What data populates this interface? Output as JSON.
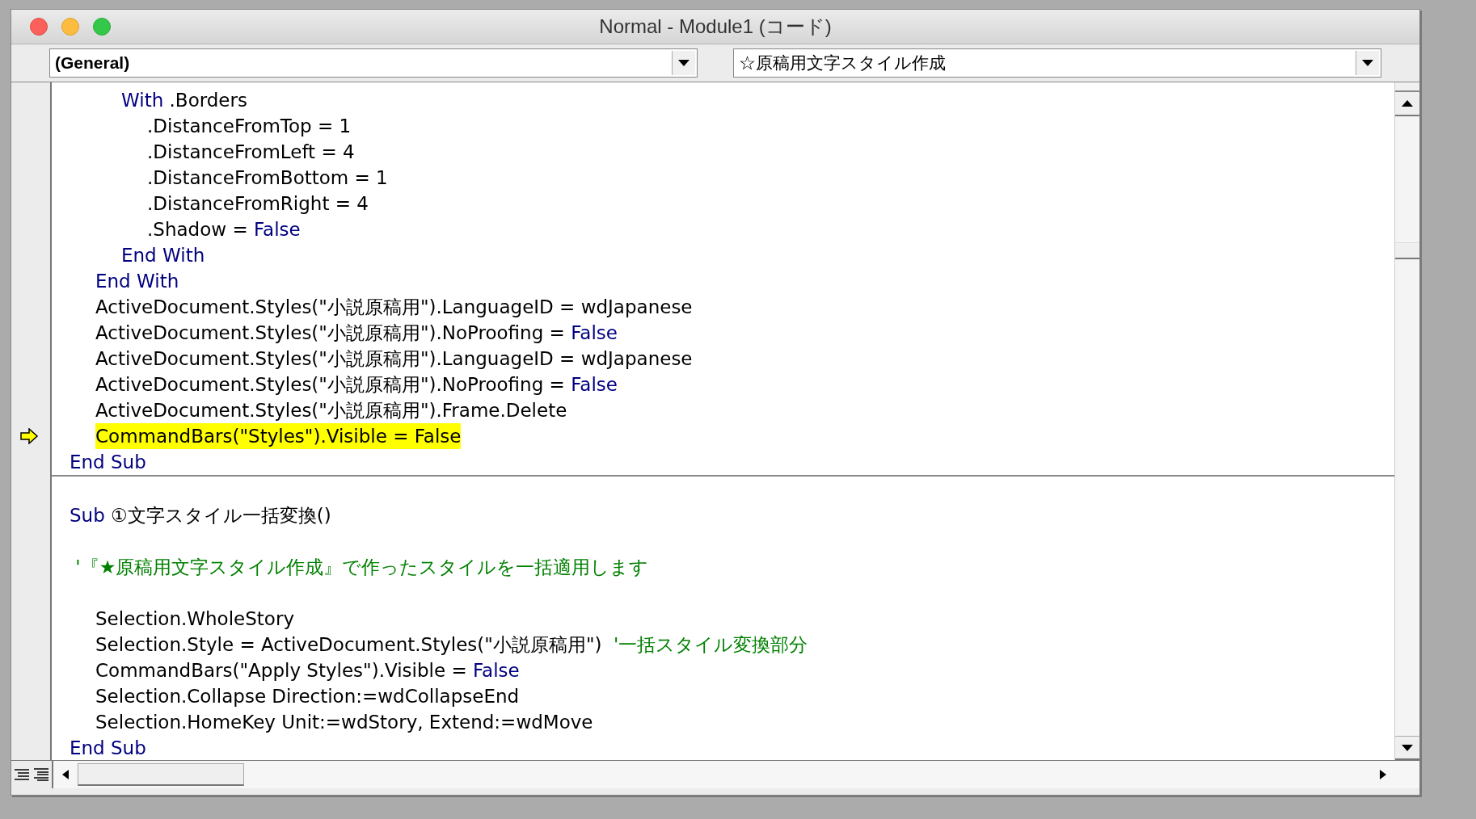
{
  "window": {
    "title": "Normal - Module1 (コード)"
  },
  "object_combo": {
    "value": "(General)"
  },
  "procedure_combo": {
    "value": "☆原稿用文字スタイル作成"
  },
  "procedures": [
    {
      "lines": [
        {
          "kind": "code",
          "current": false,
          "segments": [
            {
              "kind": "keyword",
              "text": "\t\tWith"
            },
            {
              "kind": "plain",
              "text": " .Borders"
            }
          ]
        },
        {
          "kind": "code",
          "current": false,
          "segments": [
            {
              "kind": "plain",
              "text": "\t\t\t.DistanceFromTop = 1"
            }
          ]
        },
        {
          "kind": "code",
          "current": false,
          "segments": [
            {
              "kind": "plain",
              "text": "\t\t\t.DistanceFromLeft = 4"
            }
          ]
        },
        {
          "kind": "code",
          "current": false,
          "segments": [
            {
              "kind": "plain",
              "text": "\t\t\t.DistanceFromBottom = 1"
            }
          ]
        },
        {
          "kind": "code",
          "current": false,
          "segments": [
            {
              "kind": "plain",
              "text": "\t\t\t.DistanceFromRight = 4"
            }
          ]
        },
        {
          "kind": "code",
          "current": false,
          "segments": [
            {
              "kind": "plain",
              "text": "\t\t\t.Shadow = "
            },
            {
              "kind": "keyword",
              "text": "False"
            }
          ]
        },
        {
          "kind": "code",
          "current": false,
          "segments": [
            {
              "kind": "keyword",
              "text": "\t\tEnd With"
            }
          ]
        },
        {
          "kind": "code",
          "current": false,
          "segments": [
            {
              "kind": "keyword",
              "text": "\tEnd With"
            }
          ]
        },
        {
          "kind": "code",
          "current": false,
          "segments": [
            {
              "kind": "plain",
              "text": "\tActiveDocument.Styles(\"小説原稿用\").LanguageID = wdJapanese"
            }
          ]
        },
        {
          "kind": "code",
          "current": false,
          "segments": [
            {
              "kind": "plain",
              "text": "\tActiveDocument.Styles(\"小説原稿用\").NoProofing = "
            },
            {
              "kind": "keyword",
              "text": "False"
            }
          ]
        },
        {
          "kind": "code",
          "current": false,
          "segments": [
            {
              "kind": "plain",
              "text": "\tActiveDocument.Styles(\"小説原稿用\").LanguageID = wdJapanese"
            }
          ]
        },
        {
          "kind": "code",
          "current": false,
          "segments": [
            {
              "kind": "plain",
              "text": "\tActiveDocument.Styles(\"小説原稿用\").NoProofing = "
            },
            {
              "kind": "keyword",
              "text": "False"
            }
          ]
        },
        {
          "kind": "code",
          "current": false,
          "segments": [
            {
              "kind": "plain",
              "text": "\tActiveDocument.Styles(\"小説原稿用\").Frame.Delete"
            }
          ]
        },
        {
          "kind": "code",
          "current": true,
          "segments": [
            {
              "kind": "plain",
              "text": "\tCommandBars(\"Styles\").Visible = False"
            }
          ]
        },
        {
          "kind": "code",
          "current": false,
          "segments": [
            {
              "kind": "keyword",
              "text": "End Sub"
            }
          ]
        }
      ]
    },
    {
      "lines": [
        {
          "kind": "blank"
        },
        {
          "kind": "code",
          "current": false,
          "segments": [
            {
              "kind": "keyword",
              "text": "Sub"
            },
            {
              "kind": "plain",
              "text": " ①文字スタイル一括変換()"
            }
          ]
        },
        {
          "kind": "blank"
        },
        {
          "kind": "code",
          "current": false,
          "segments": [
            {
              "kind": "comment",
              "text": " '『★原稿用文字スタイル作成』で作ったスタイルを一括適用します"
            }
          ]
        },
        {
          "kind": "blank"
        },
        {
          "kind": "code",
          "current": false,
          "segments": [
            {
              "kind": "plain",
              "text": "\tSelection.WholeStory"
            }
          ]
        },
        {
          "kind": "code",
          "current": false,
          "segments": [
            {
              "kind": "plain",
              "text": "\tSelection.Style = ActiveDocument.Styles(\"小説原稿用\")"
            },
            {
              "kind": "comment",
              "text": "  '一括スタイル変換部分"
            }
          ]
        },
        {
          "kind": "code",
          "current": false,
          "segments": [
            {
              "kind": "plain",
              "text": "\tCommandBars(\"Apply Styles\").Visible = "
            },
            {
              "kind": "keyword",
              "text": "False"
            }
          ]
        },
        {
          "kind": "code",
          "current": false,
          "segments": [
            {
              "kind": "plain",
              "text": "\tSelection.Collapse Direction:=wdCollapseEnd"
            }
          ]
        },
        {
          "kind": "code",
          "current": false,
          "segments": [
            {
              "kind": "plain",
              "text": "\tSelection.HomeKey Unit:=wdStory, Extend:=wdMove"
            }
          ]
        },
        {
          "kind": "code",
          "current": false,
          "segments": [
            {
              "kind": "keyword",
              "text": "End Sub"
            }
          ]
        }
      ]
    }
  ]
}
